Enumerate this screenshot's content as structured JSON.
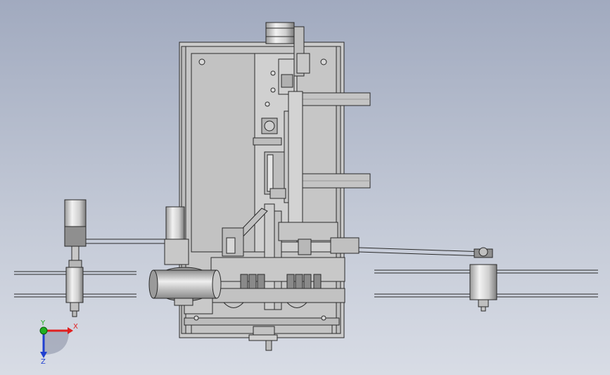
{
  "viewport": {
    "background_top": "#a1aabf",
    "background_bottom": "#d8dce5",
    "part_color": "#c9c9c9",
    "edge_color": "#2a2a2a"
  },
  "model": {
    "components": [
      "main-frame",
      "top-stepper-motor",
      "left-spool-motor",
      "left-supply-reel",
      "right-takeup-reel",
      "left-cylinder-drum",
      "right-support-arms",
      "bottom-handwheel",
      "vertical-slide-rail",
      "roller-assembly"
    ]
  },
  "triad": {
    "x_label": "X",
    "y_label": "Y",
    "z_label": "Z",
    "x_color": "#e02020",
    "y_color": "#20b020",
    "z_color": "#2040d0"
  }
}
